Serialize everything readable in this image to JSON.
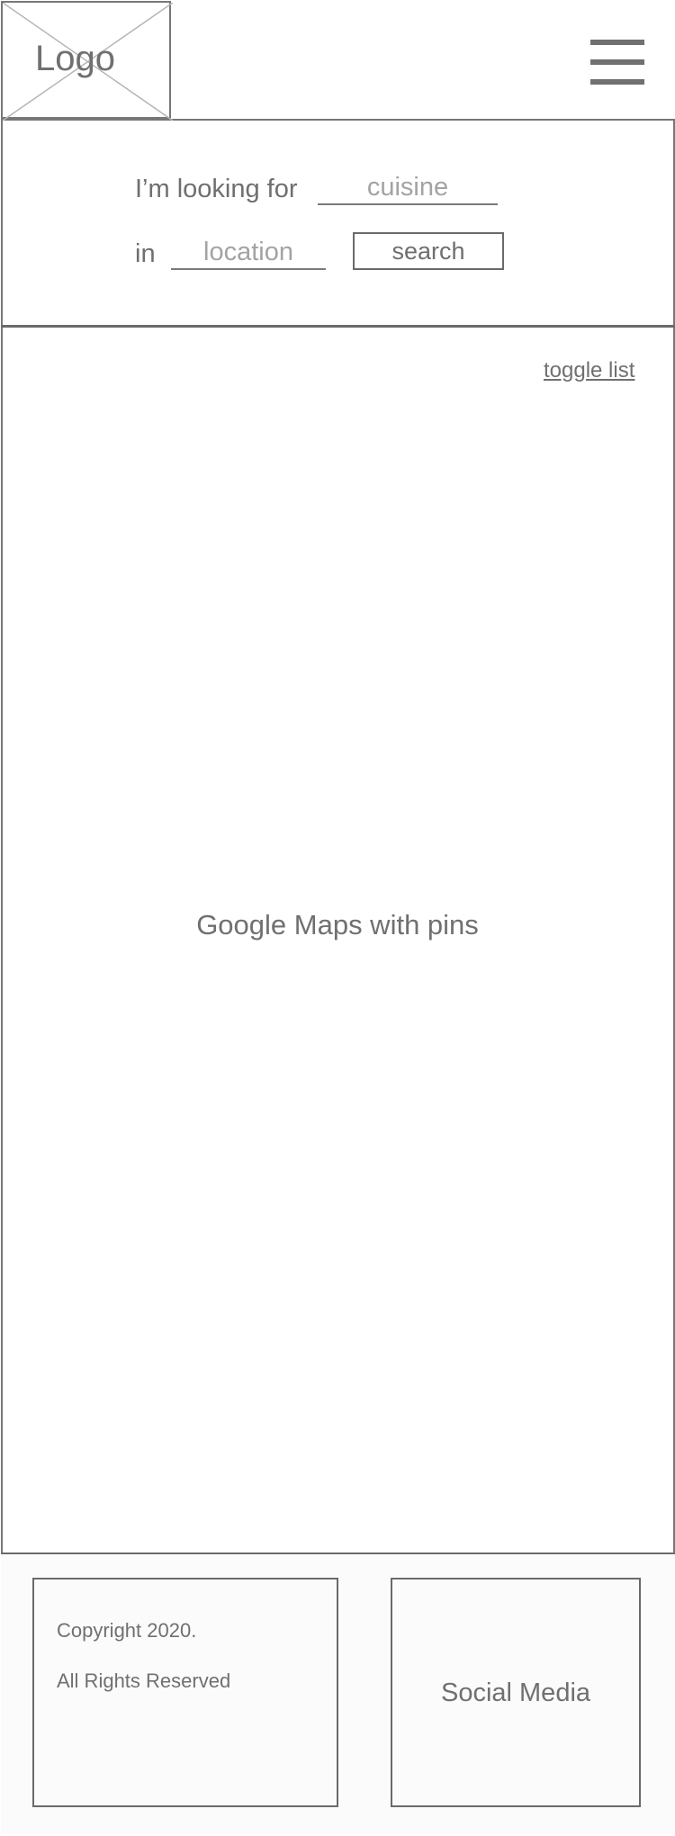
{
  "header": {
    "logo_text": "Logo",
    "menu_icon": "hamburger-menu-icon"
  },
  "search": {
    "prefix_label": "I’m looking for",
    "cuisine_placeholder": "cuisine",
    "location_prefix": "in",
    "location_placeholder": "location",
    "button_label": "search"
  },
  "map": {
    "toggle_label": "toggle list",
    "placeholder_label": "Google Maps with pins"
  },
  "footer": {
    "copyright_line1": "Copyright 2020.",
    "copyright_line2": "All Rights Reserved",
    "social_label": "Social Media"
  }
}
